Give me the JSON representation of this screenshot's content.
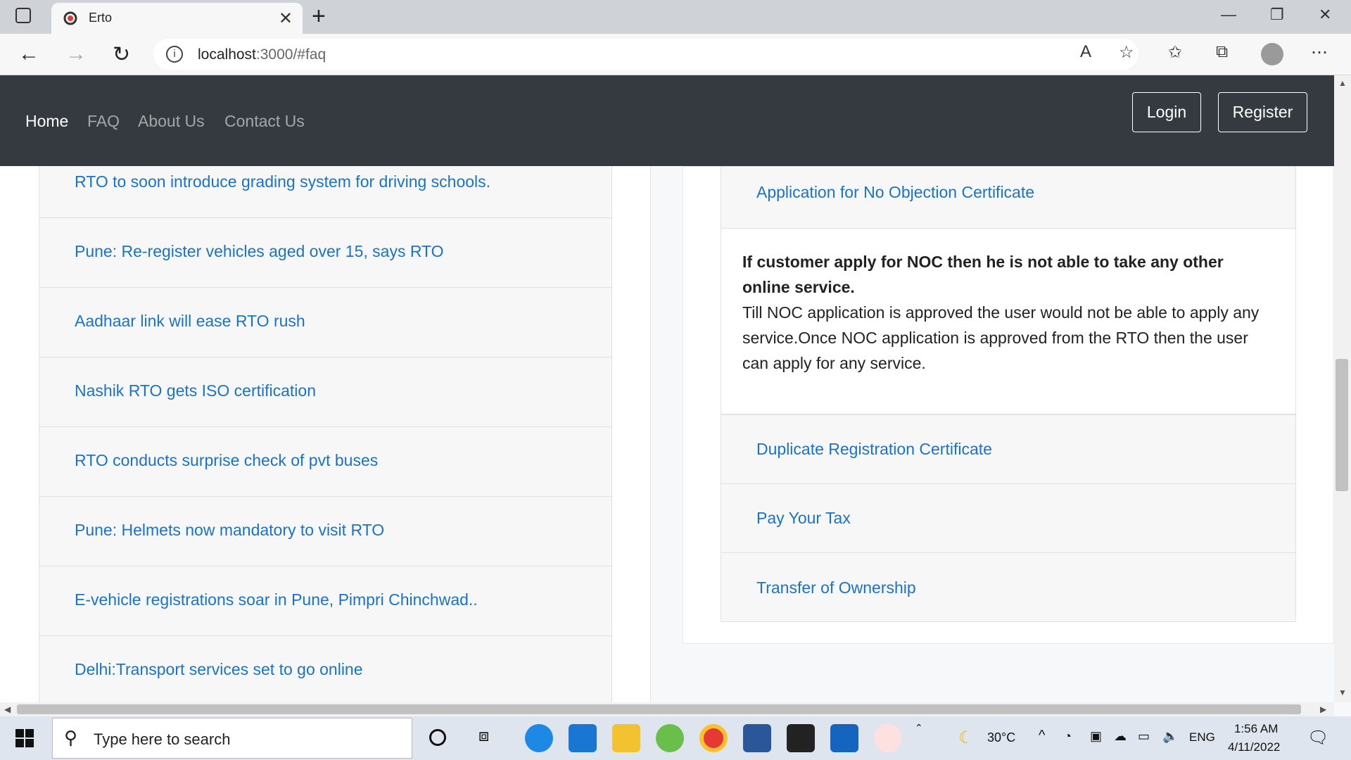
{
  "browser": {
    "tab_title": "Erto",
    "url_host": "localhost",
    "url_rest": ":3000/#faq"
  },
  "navbar": {
    "links": [
      "Home",
      "FAQ",
      "About Us",
      "Contact Us"
    ],
    "login_label": "Login",
    "register_label": "Register"
  },
  "news": [
    "RTO to soon introduce grading system for driving schools.",
    "Pune: Re-register vehicles aged over 15, says RTO",
    "Aadhaar link will ease RTO rush",
    "Nashik RTO gets ISO certification",
    "RTO conducts surprise check of pvt buses",
    "Pune: Helmets now mandatory to visit RTO",
    "E-vehicle registrations soar in Pune, Pimpri Chinchwad..",
    "Delhi:Transport services set to go online"
  ],
  "faq": {
    "open_question": "Application for No Objection Certificate",
    "answer_bold": "If customer apply for NOC then he is not able to take any other online service.",
    "answer_text": "Till NOC application is approved the user would not be able to apply any service.Once NOC application is approved from the RTO then the user can apply for any service.",
    "questions": [
      "Duplicate Registration Certificate",
      "Pay Your Tax",
      "Transfer of Ownership"
    ]
  },
  "taskbar": {
    "search_placeholder": "Type here to search",
    "weather": "30°C",
    "language": "ENG",
    "time": "1:56 AM",
    "date": "4/11/2022"
  },
  "icons": [
    "tab-favicon",
    "search-icon",
    "windows-start-icon",
    "moon-icon"
  ],
  "colors": {
    "navbar": "#343a40",
    "link": "#1a73c9"
  }
}
